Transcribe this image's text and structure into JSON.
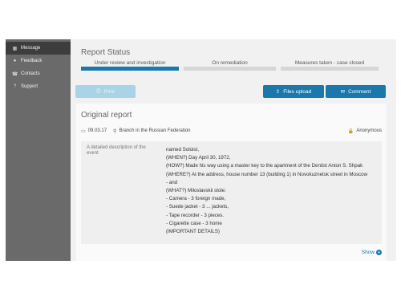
{
  "sidebar": {
    "items": [
      {
        "label": "Message",
        "icon": "grid-icon"
      },
      {
        "label": "Feedback",
        "icon": "chat-icon"
      },
      {
        "label": "Contacts",
        "icon": "phone-icon"
      },
      {
        "label": "Support",
        "icon": "question-icon"
      }
    ]
  },
  "status": {
    "title": "Report Status",
    "steps": [
      {
        "label": "Under review and investigation",
        "active": true
      },
      {
        "label": "On remediation",
        "active": false
      },
      {
        "label": "Measures taken - case closed",
        "active": false
      }
    ]
  },
  "actions": {
    "print": "Print",
    "upload": "Files upload",
    "comment": "Comment"
  },
  "report": {
    "title": "Original report",
    "date": "09.03.17",
    "location": "Branch in the Russian Federation",
    "anonymity": "Anonymous",
    "detail_label": "A detailed description of the event",
    "lines": [
      "named Soloist,",
      "(WHEN?) Day April 30, 1972,",
      "(HOW?) Made his way using a master key to the apartment of the Dentist Anton S. Shpak",
      "(WHERE?) At the address, house number 13 (building 1) in Novokuznetsk street in Moscow",
      "- and",
      "(WHAT?) Miloslavskii stole:",
      "- Camera - 3 foreign made,",
      "- Suede jacket - 3 ... jackets,",
      "- Tape recorder - 3 pieces.",
      "- Cigarette case - 3 home",
      "(IMPORTANT DETAILS)"
    ],
    "show_label": "Show"
  },
  "colors": {
    "accent": "#1a78ad",
    "sidebar": "#6a6a6a",
    "sidebar_active": "#3d3d3d"
  }
}
